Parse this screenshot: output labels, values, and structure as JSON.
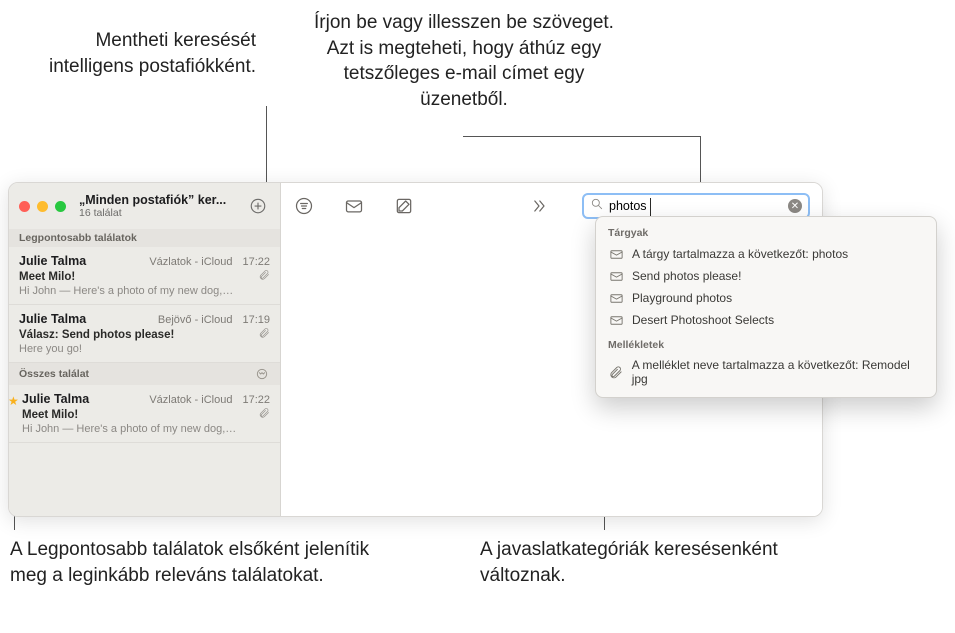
{
  "callouts": {
    "save_search": "Mentheti keresését intelligens postafiókként.",
    "type_paste": "Írjon be vagy illesszen be szöveget. Azt is megteheti, hogy áthúz egy tetszőleges e-mail címet egy üzenetből.",
    "top_hits": "A Legpontosabb találatok elsőként jelenítik meg a leginkább releváns találatokat.",
    "suggestion_cats": "A javaslatkategóriák keresésenként változnak."
  },
  "window": {
    "title": "„Minden postafiók” ker...",
    "subtitle": "16 találat"
  },
  "sections": {
    "top_hits": "Legpontosabb találatok",
    "all_results": "Összes találat"
  },
  "messages": [
    {
      "from": "Julie Talma",
      "mailbox": "Vázlatok - iCloud",
      "time": "17:22",
      "subject": "Meet Milo!",
      "preview": "Hi John — Here's a photo of my new dog,…",
      "attachment": true,
      "flagged": false
    },
    {
      "from": "Julie Talma",
      "mailbox": "Bejövő - iCloud",
      "time": "17:19",
      "subject": "Válasz: Send photos please!",
      "preview": "Here you go!",
      "attachment": true,
      "flagged": false
    },
    {
      "from": "Julie Talma",
      "mailbox": "Vázlatok - iCloud",
      "time": "17:22",
      "subject": "Meet Milo!",
      "preview": "Hi John — Here's a photo of my new dog,…",
      "attachment": true,
      "flagged": true
    }
  ],
  "search": {
    "value": "photos",
    "placeholder": ""
  },
  "suggestions": {
    "subjects_label": "Tárgyak",
    "subjects": [
      "A tárgy tartalmazza a következőt: photos",
      "Send photos please!",
      "Playground photos",
      "Desert Photoshoot Selects"
    ],
    "attachments_label": "Mellékletek",
    "attachments": [
      "A melléklet neve tartalmazza a következőt: Remodel jpg"
    ]
  }
}
